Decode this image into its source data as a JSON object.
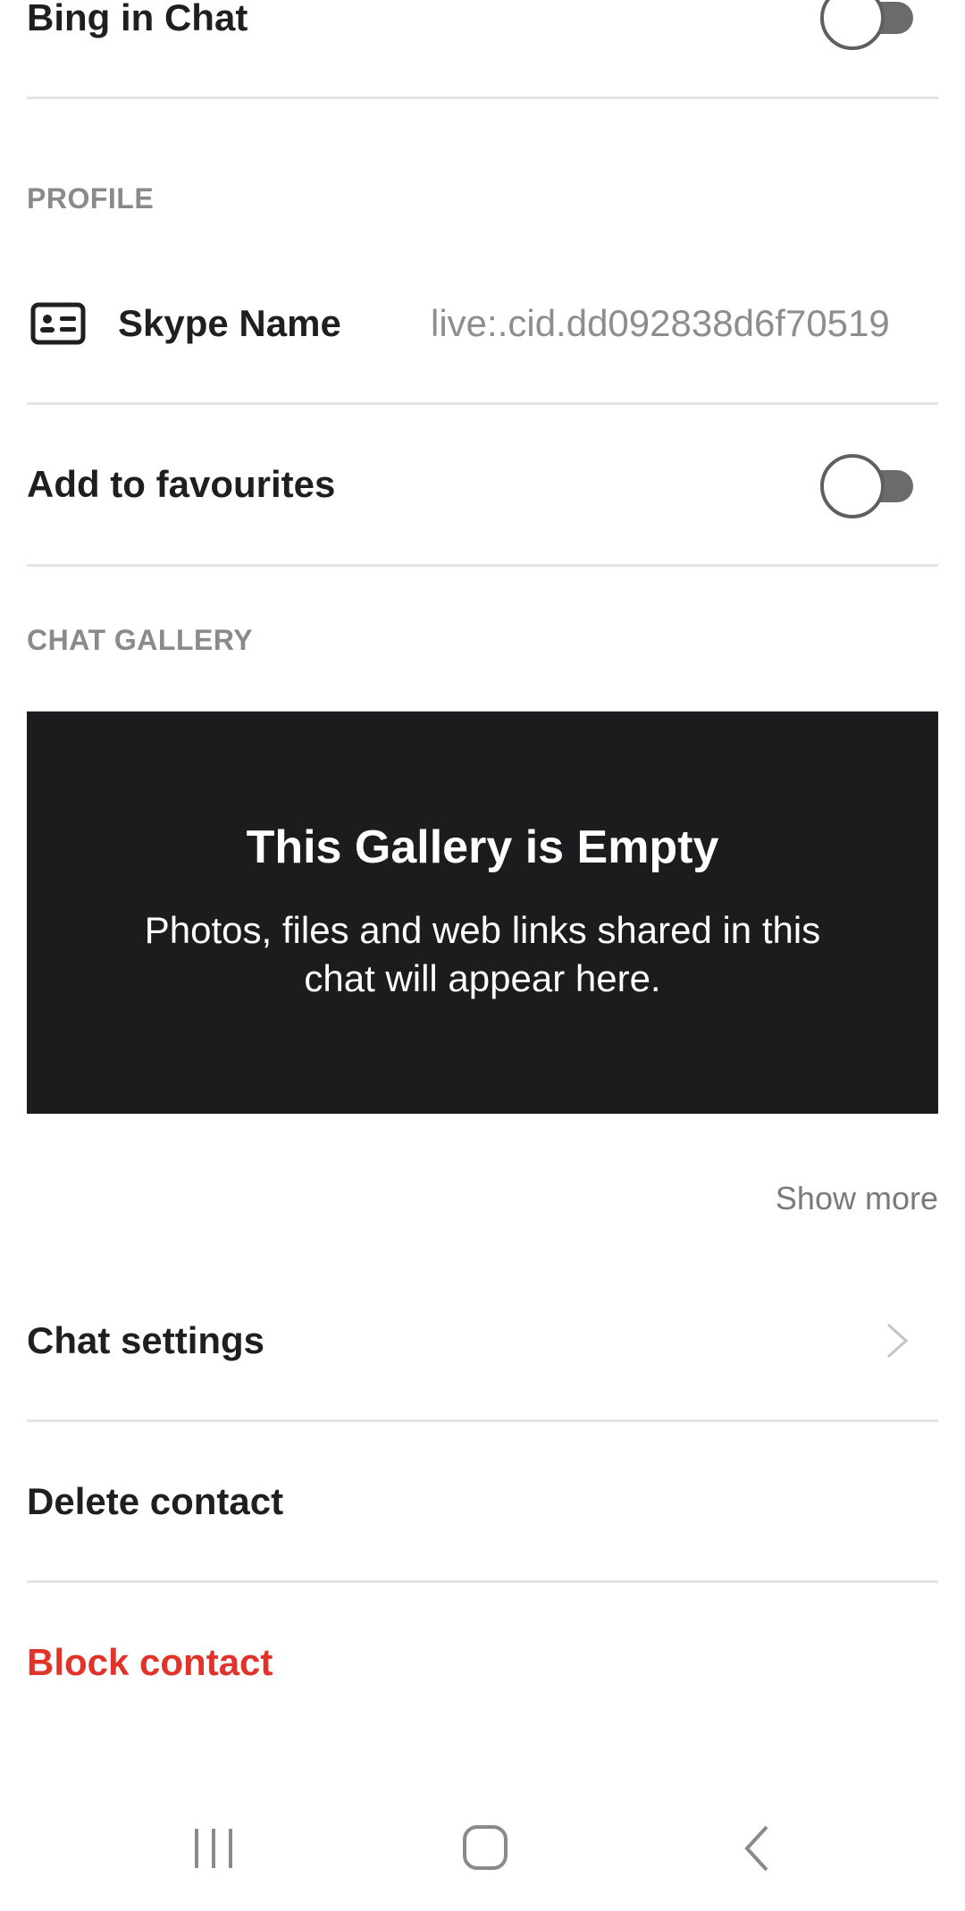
{
  "settings": {
    "bing_in_chat": {
      "label": "Bing in Chat",
      "enabled": false
    }
  },
  "profile": {
    "header": "PROFILE",
    "skype_name_label": "Skype Name",
    "skype_name_value": "live:.cid.dd092838d6f70519",
    "icon": "contact-card-icon"
  },
  "favourites": {
    "label": "Add to favourites",
    "enabled": false
  },
  "gallery": {
    "header": "CHAT GALLERY",
    "empty_title": "This Gallery is Empty",
    "empty_text": "Photos, files and web links shared in this chat will appear here.",
    "show_more": "Show more"
  },
  "actions": {
    "chat_settings": "Chat settings",
    "delete_contact": "Delete contact",
    "block_contact": "Block contact"
  },
  "nav": {
    "recent_icon": "recent-apps-icon",
    "home_icon": "home-icon",
    "back_icon": "back-icon"
  },
  "colors": {
    "danger": "#e0342b",
    "gallery_bg": "#1c1c1e",
    "muted": "#8a8a8a"
  }
}
